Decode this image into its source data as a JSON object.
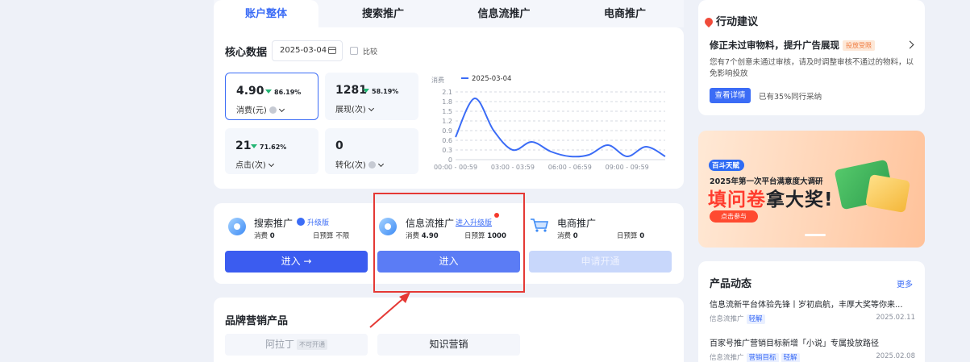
{
  "tabs": [
    {
      "label": "账户整体",
      "active": true
    },
    {
      "label": "搜索推广",
      "active": false
    },
    {
      "label": "信息流推广",
      "active": false
    },
    {
      "label": "电商推广",
      "active": false
    }
  ],
  "core": {
    "title": "核心数据",
    "date": "2025-03-04",
    "compare_label": "比较",
    "metrics": [
      {
        "value": "4.90",
        "change": "86.19%",
        "name": "消费(元)",
        "has_info": true,
        "selected": true
      },
      {
        "value": "1281",
        "change": "58.19%",
        "name": "展现(次)",
        "has_info": false,
        "selected": false
      },
      {
        "value": "21",
        "change": "71.62%",
        "name": "点击(次)",
        "has_info": false,
        "selected": false
      },
      {
        "value": "0",
        "change": "",
        "name": "转化(次)",
        "has_info": true,
        "selected": false
      }
    ]
  },
  "chart_data": {
    "type": "line",
    "legend": [
      "2025-03-04"
    ],
    "ylabel": "消费",
    "yticks": [
      "2.1",
      "1.8",
      "1.5",
      "1.2",
      "0.9",
      "0.6",
      "0.3",
      "0"
    ],
    "ylim": [
      0,
      2.1
    ],
    "x_tick_labels": [
      "00:00 - 00:59",
      "03:00 - 03:59",
      "06:00 - 06:59",
      "09:00 - 09:59"
    ],
    "series": [
      {
        "name": "2025-03-04",
        "color": "#3b6cf6",
        "x": [
          0,
          1,
          2,
          3,
          4,
          5,
          6,
          7,
          8,
          9,
          10,
          11
        ],
        "values": [
          0.7,
          1.9,
          0.9,
          0.3,
          0.55,
          0.25,
          0.1,
          0.15,
          0.45,
          0.1,
          0.4,
          0.1
        ]
      }
    ],
    "grid": true,
    "legend_position": "top-left"
  },
  "products": [
    {
      "name": "搜索推广",
      "upgrade": "升级版",
      "spend_label": "消费",
      "spend": "0",
      "budget_label": "日预算",
      "budget": "不限",
      "button": "进入 →",
      "enabled": true
    },
    {
      "name": "信息流推广",
      "upgrade": "进入升级版",
      "spend_label": "消费",
      "spend": "4.90",
      "budget_label": "日预算",
      "budget": "1000",
      "button": "进入",
      "enabled": true,
      "notify": true
    },
    {
      "name": "电商推广",
      "upgrade": "",
      "spend_label": "消费",
      "spend": "0",
      "budget_label": "日预算",
      "budget": "0",
      "button": "申请开通",
      "enabled": false
    }
  ],
  "brand": {
    "title": "品牌营销产品",
    "items": [
      {
        "label": "阿拉丁",
        "tag": "不可开通",
        "enabled": false
      },
      {
        "label": "知识营销",
        "tag": "",
        "enabled": true
      }
    ]
  },
  "action": {
    "header": "行动建议",
    "title": "修正未过审物料，提升广告展现",
    "tag": "投放受限",
    "desc": "您有7个创意未通过审核，请及时调整审核不通过的物料，以免影响投放",
    "button": "查看详情",
    "note": "已有35%同行采纳"
  },
  "banner": {
    "logo": "百斗天赋",
    "line": "2025年第一次平台满意度大调研",
    "big_red": "填问卷",
    "big_black": "拿大奖!",
    "button": "点击参与"
  },
  "news": {
    "title": "产品动态",
    "more": "更多",
    "items": [
      {
        "title": "信息流新平台体验先锋丨岁初启航，丰厚大奖等你来...",
        "category": "信息流推广",
        "tags": [
          "轻解"
        ],
        "date": "2025.02.11"
      },
      {
        "title": "百家号推广营销目标新增「小说」专属投放路径",
        "category": "信息流推广",
        "tags": [
          "营销目标",
          "轻解"
        ],
        "date": "2025.02.08"
      }
    ]
  }
}
